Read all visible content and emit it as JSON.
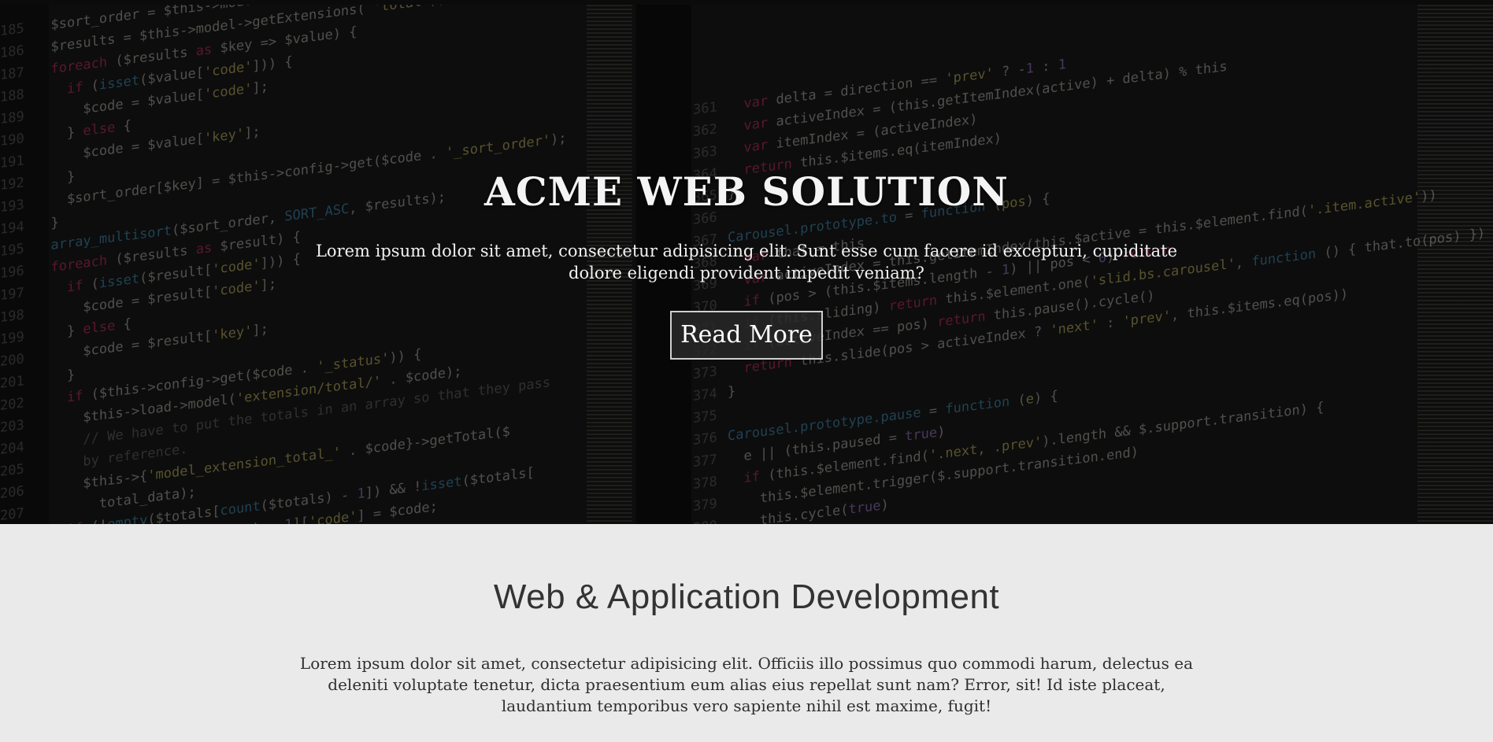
{
  "hero": {
    "title": "ACME WEB SOLUTION",
    "text": "Lorem ipsum dolor sit amet, consectetur adipisicing elit. Sunt esse cum facere id excepturi, cupiditate dolore eligendi provident impedit veniam?",
    "button_label": "Read More"
  },
  "section": {
    "title": "Web & Application Development",
    "text": "Lorem ipsum dolor sit amet, consectetur adipisicing elit. Officiis illo possimus quo commodi harum, delectus ea deleniti voluptate tenetur, dicta praesentium eum alias eius repellat sunt nam? Error, sit! Id iste placeat, laudantium temporibus vero sapiente nihil est maxime, fugit!"
  },
  "colors": {
    "hero_background": "#141414",
    "section_background": "#eaeaea",
    "heading_text": "#333333"
  }
}
